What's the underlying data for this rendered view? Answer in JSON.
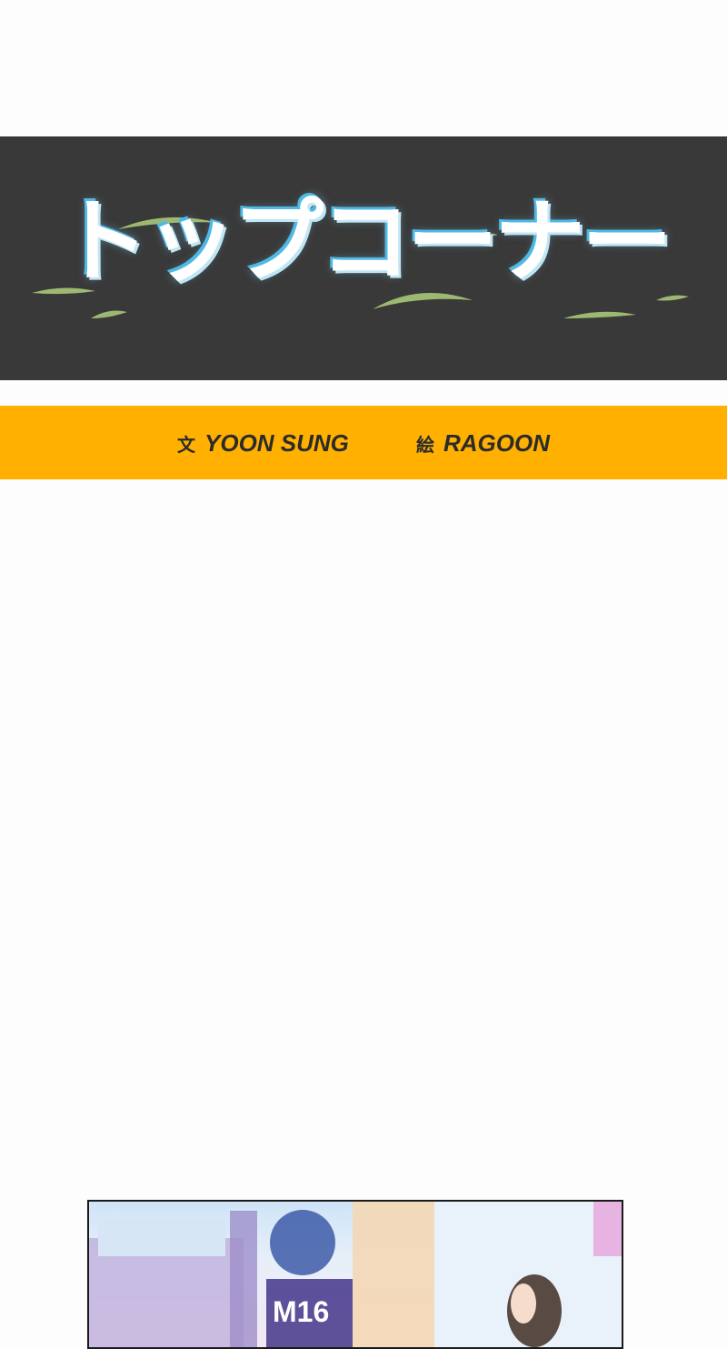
{
  "title": {
    "text": "トップコーナー"
  },
  "credits": {
    "writer_prefix": "文",
    "writer_name": "YOON SUNG",
    "artist_prefix": "絵",
    "artist_name": "RAGOON"
  },
  "panel": {
    "sign_text": "M16"
  },
  "colors": {
    "banner_bg": "#393939",
    "credits_bg": "#ffb000",
    "title_glow": "#4fb9e6",
    "leaf": "#a9c878"
  }
}
